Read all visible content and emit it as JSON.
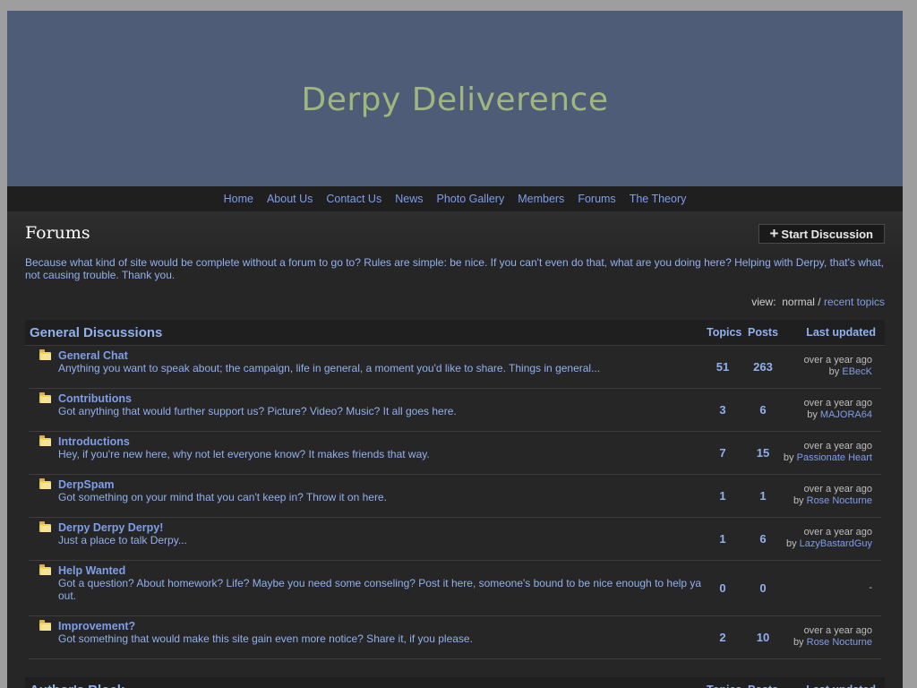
{
  "site": {
    "title": "Derpy Deliverence"
  },
  "nav": [
    "Home",
    "About Us",
    "Contact Us",
    "News",
    "Photo Gallery",
    "Members",
    "Forums",
    "The Theory"
  ],
  "page": {
    "title": "Forums",
    "start_button": "Start Discussion",
    "intro": "Because what kind of site would be complete without a forum to go to? Rules are simple: be nice. If you can't even do that, what are you doing here? Helping with Derpy, that's what, not causing trouble. Thank you.",
    "view_label": "view:",
    "view_current": "normal",
    "view_sep": "/",
    "view_other": "recent topics"
  },
  "sections": [
    {
      "title": "General Discussions",
      "col_topics": "Topics",
      "col_posts": "Posts",
      "col_last": "Last updated",
      "forums": [
        {
          "name": "General Chat",
          "desc": "Anything you want to speak about; the campaign, life in general, a moment you'd like to share. Things in general...",
          "topics": "51",
          "posts": "263",
          "when": "over a year ago",
          "by": "by",
          "user": "EBecK"
        },
        {
          "name": "Contributions",
          "desc": "Got anything that would further support us? Picture? Video? Music? It all goes here.",
          "topics": "3",
          "posts": "6",
          "when": "over a year ago",
          "by": "by",
          "user": "MAJORA64"
        },
        {
          "name": "Introductions",
          "desc": "Hey, if you're new here, why not let everyone know? It makes friends that way.",
          "topics": "7",
          "posts": "15",
          "when": "over a year ago",
          "by": "by",
          "user": "Passionate Heart"
        },
        {
          "name": "DerpSpam",
          "desc": "Got something on your mind that you can't keep in? Throw it on here.",
          "topics": "1",
          "posts": "1",
          "when": "over a year ago",
          "by": "by",
          "user": "Rose Nocturne"
        },
        {
          "name": "Derpy Derpy Derpy!",
          "desc": "Just a place to talk Derpy...",
          "topics": "1",
          "posts": "6",
          "when": "over a year ago",
          "by": "by",
          "user": "LazyBastardGuy"
        },
        {
          "name": "Help Wanted",
          "desc": "Got a question? About homework? Life? Maybe you need some conseling? Post it here, someone's bound to be nice enough to help ya out.",
          "topics": "0",
          "posts": "0",
          "when": "-",
          "by": "",
          "user": ""
        },
        {
          "name": "Improvement?",
          "desc": "Got something that would make this site gain even more notice? Share it, if you please.",
          "topics": "2",
          "posts": "10",
          "when": "over a year ago",
          "by": "by",
          "user": "Rose Nocturne"
        }
      ]
    },
    {
      "title": "Author's Block",
      "col_topics": "Topics",
      "col_posts": "Posts",
      "col_last": "Last updated",
      "forums": []
    }
  ]
}
